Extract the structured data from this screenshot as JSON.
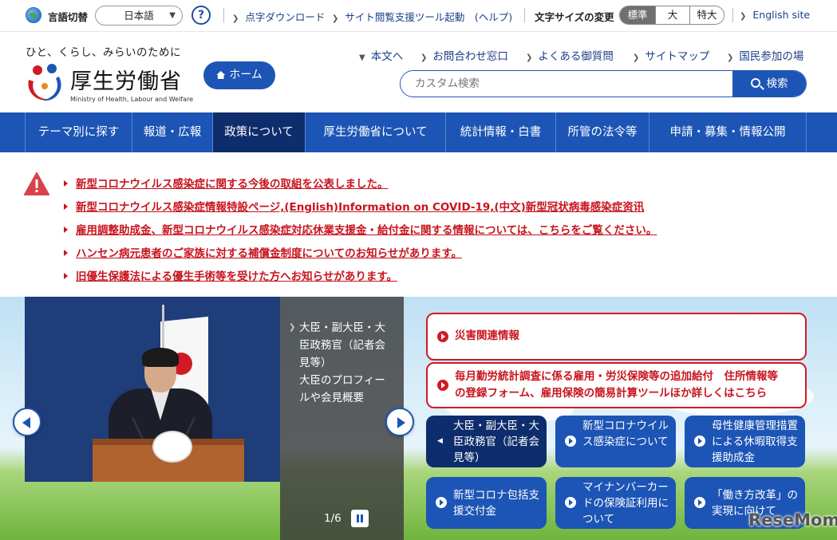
{
  "utility": {
    "lang_label": "言語切替",
    "lang_value": "日本語",
    "help_mark": "?",
    "links": [
      "点字ダウンロード",
      "サイト閲覧支援ツール起動　(ヘルプ)"
    ],
    "fontsize_label": "文字サイズの変更",
    "fontsize_options": [
      "標準",
      "大",
      "特大"
    ],
    "english": "English site"
  },
  "header": {
    "tagline": "ひと、くらし、みらいのために",
    "logo_ja": "厚生労働省",
    "logo_en": "Ministry of Health, Labour and Welfare",
    "home": "ホーム",
    "links": [
      "本文へ",
      "お問合わせ窓口",
      "よくある御質問",
      "サイトマップ",
      "国民参加の場"
    ],
    "search_placeholder": "カスタム検索",
    "search_button": "検索"
  },
  "nav": {
    "items": [
      "テーマ別に探す",
      "報道・広報",
      "政策について",
      "厚生労働省について",
      "統計情報・白書",
      "所管の法令等",
      "申請・募集・情報公開"
    ],
    "active_index": 2
  },
  "alerts": [
    "新型コロナウイルス感染症に関する今後の取組を公表しました。",
    "新型コロナウイルス感染症情報特設ページ,(English)Information on COVID-19,(中文)新型冠状病毒感染症资讯",
    "雇用調整助成金、新型コロナウイルス感染症対応休業支援金・給付金に関する情報については、こちらをご覧ください。",
    "ハンセン病元患者のご家族に対する補償金制度についてのお知らせがあります。",
    "旧優生保護法による優生手術等を受けた方へお知らせがあります。"
  ],
  "slide": {
    "title": "大臣・副大臣・大臣政務官（記者会見等）",
    "desc": "大臣のプロフィールや会見概要",
    "counter": "1/6"
  },
  "cards": {
    "disaster": "災害関連情報",
    "monthly_line1": "毎月勤労統計調査に係る雇用・労災保険等の追加給付　住所情報等",
    "monthly_line2": "の登録フォーム、雇用保険の簡易計算ツールほか詳しくはこちら"
  },
  "tiles": [
    "大臣・副大臣・大臣政務官（記者会見等）",
    "新型コロナウイルス感染症について",
    "母性健康管理措置による休暇取得支援助成金",
    "新型コロナ包括支援交付金",
    "マイナンバーカードの保険証利用について",
    "「働き方改革」の実現に向けて"
  ],
  "watermark": "ReseMom",
  "colors": {
    "primary": "#1c55b5",
    "nav_active": "#0e2d6d",
    "alert_red": "#c8141e"
  }
}
